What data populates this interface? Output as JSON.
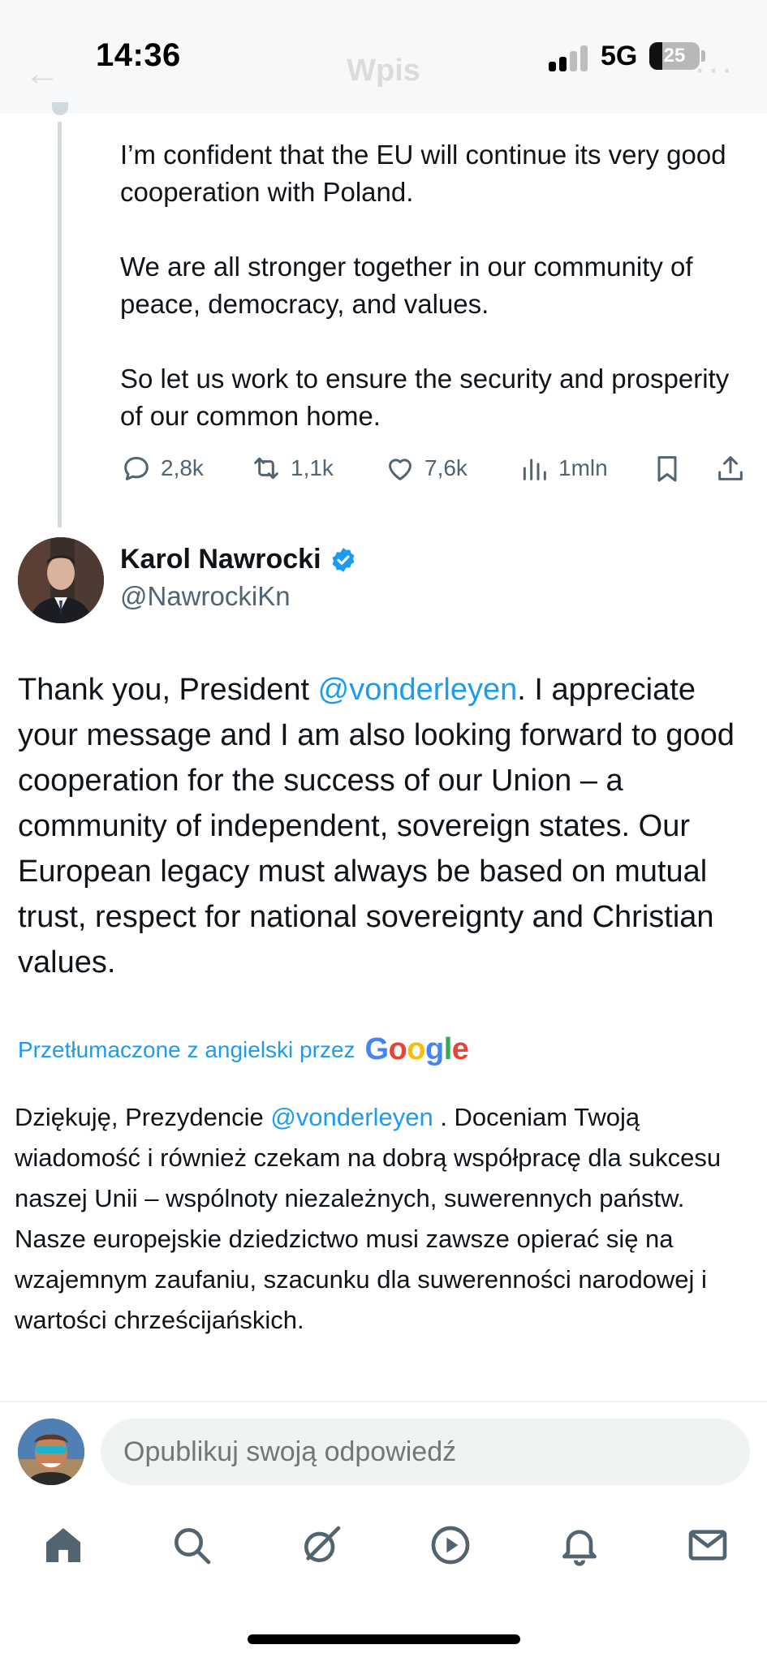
{
  "status_bar": {
    "time": "14:36",
    "network": "5G",
    "battery": "25",
    "battery_level": 0.25
  },
  "nav": {
    "back_icon": "arrow-left-icon",
    "title": "Wpis",
    "more_icon": "more-icon"
  },
  "previous_tweet": {
    "paragraphs": [
      "I’m confident that the EU will continue its very good cooperation with Poland.",
      "We are all stronger together in our community of peace, democracy, and values.",
      "So let us work to ensure the security and prosperity of our common home."
    ],
    "actions": {
      "replies": "2,8k",
      "reposts": "1,1k",
      "likes": "7,6k",
      "views": "1mln"
    }
  },
  "tweet": {
    "author_name": "Karol Nawrocki",
    "author_handle": "@NawrockiKn",
    "verified": true,
    "text_before_mention": "Thank you, President ",
    "mention": "@vonderleyen",
    "text_after_mention": ". I appreciate your message and I am also looking forward to good cooperation for the success of our Union – a community of independent, sovereign states. Our European legacy must always be based on mutual trust, respect for national sovereignty and Christian values.",
    "translated_label": "Przetłumaczone z angielski przez",
    "translator": "Google",
    "translated_before_mention": "Dziękuję, Prezydencie ",
    "translated_mention": "@vonderleyen",
    "translated_after_mention": " . Doceniam Twoją wiadomość i również czekam na dobrą współpracę dla sukcesu naszej Unii – wspólnoty niezależnych, suwerennych państw. Nasze europejskie dziedzictwo musi zawsze opierać się na wzajemnym zaufaniu, szacunku dla suwerenności narodowej i wartości chrześcijańskich."
  },
  "reply": {
    "placeholder": "Opublikuj swoją odpowiedź"
  },
  "tabbar": [
    "home-icon",
    "search-icon",
    "grok-icon",
    "video-icon",
    "notifications-icon",
    "messages-icon"
  ],
  "colors": {
    "accent": "#1d9bf0",
    "muted": "#536471",
    "text": "#0f1419"
  }
}
